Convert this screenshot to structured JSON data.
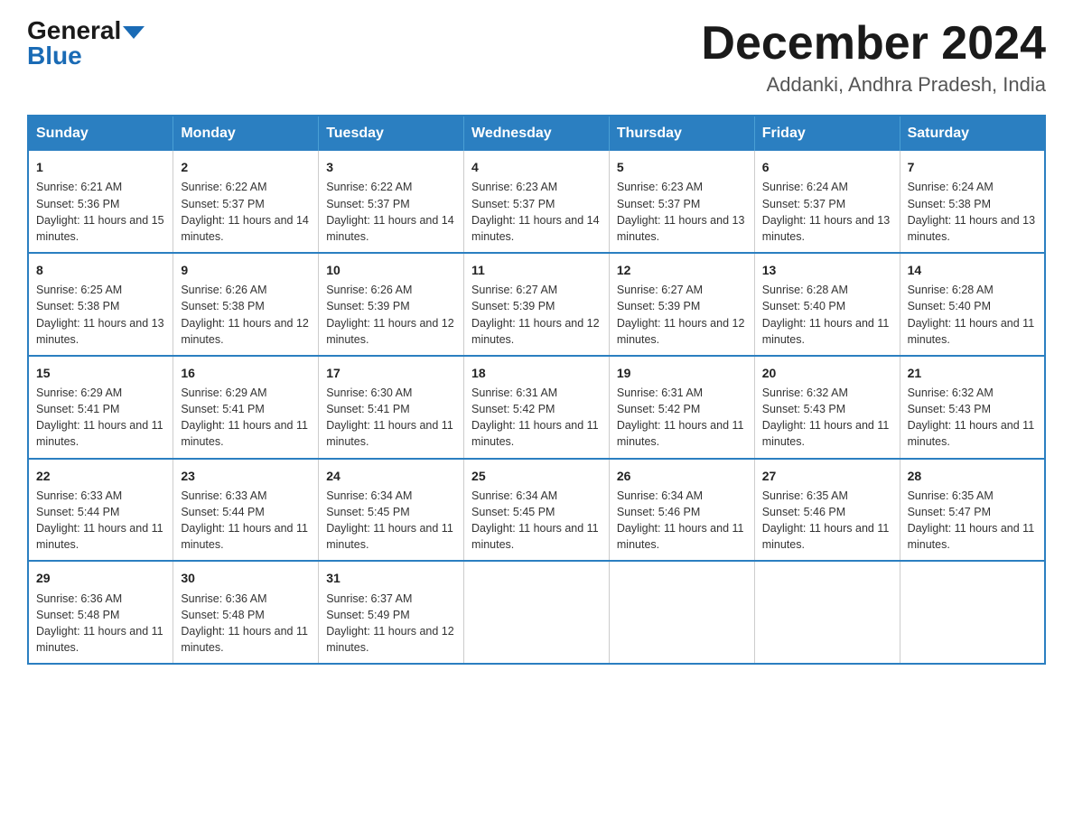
{
  "logo": {
    "line1": "General",
    "line2": "Blue"
  },
  "title": {
    "month_year": "December 2024",
    "location": "Addanki, Andhra Pradesh, India"
  },
  "headers": [
    "Sunday",
    "Monday",
    "Tuesday",
    "Wednesday",
    "Thursday",
    "Friday",
    "Saturday"
  ],
  "weeks": [
    [
      {
        "day": "1",
        "sunrise": "6:21 AM",
        "sunset": "5:36 PM",
        "daylight": "11 hours and 15 minutes."
      },
      {
        "day": "2",
        "sunrise": "6:22 AM",
        "sunset": "5:37 PM",
        "daylight": "11 hours and 14 minutes."
      },
      {
        "day": "3",
        "sunrise": "6:22 AM",
        "sunset": "5:37 PM",
        "daylight": "11 hours and 14 minutes."
      },
      {
        "day": "4",
        "sunrise": "6:23 AM",
        "sunset": "5:37 PM",
        "daylight": "11 hours and 14 minutes."
      },
      {
        "day": "5",
        "sunrise": "6:23 AM",
        "sunset": "5:37 PM",
        "daylight": "11 hours and 13 minutes."
      },
      {
        "day": "6",
        "sunrise": "6:24 AM",
        "sunset": "5:37 PM",
        "daylight": "11 hours and 13 minutes."
      },
      {
        "day": "7",
        "sunrise": "6:24 AM",
        "sunset": "5:38 PM",
        "daylight": "11 hours and 13 minutes."
      }
    ],
    [
      {
        "day": "8",
        "sunrise": "6:25 AM",
        "sunset": "5:38 PM",
        "daylight": "11 hours and 13 minutes."
      },
      {
        "day": "9",
        "sunrise": "6:26 AM",
        "sunset": "5:38 PM",
        "daylight": "11 hours and 12 minutes."
      },
      {
        "day": "10",
        "sunrise": "6:26 AM",
        "sunset": "5:39 PM",
        "daylight": "11 hours and 12 minutes."
      },
      {
        "day": "11",
        "sunrise": "6:27 AM",
        "sunset": "5:39 PM",
        "daylight": "11 hours and 12 minutes."
      },
      {
        "day": "12",
        "sunrise": "6:27 AM",
        "sunset": "5:39 PM",
        "daylight": "11 hours and 12 minutes."
      },
      {
        "day": "13",
        "sunrise": "6:28 AM",
        "sunset": "5:40 PM",
        "daylight": "11 hours and 11 minutes."
      },
      {
        "day": "14",
        "sunrise": "6:28 AM",
        "sunset": "5:40 PM",
        "daylight": "11 hours and 11 minutes."
      }
    ],
    [
      {
        "day": "15",
        "sunrise": "6:29 AM",
        "sunset": "5:41 PM",
        "daylight": "11 hours and 11 minutes."
      },
      {
        "day": "16",
        "sunrise": "6:29 AM",
        "sunset": "5:41 PM",
        "daylight": "11 hours and 11 minutes."
      },
      {
        "day": "17",
        "sunrise": "6:30 AM",
        "sunset": "5:41 PM",
        "daylight": "11 hours and 11 minutes."
      },
      {
        "day": "18",
        "sunrise": "6:31 AM",
        "sunset": "5:42 PM",
        "daylight": "11 hours and 11 minutes."
      },
      {
        "day": "19",
        "sunrise": "6:31 AM",
        "sunset": "5:42 PM",
        "daylight": "11 hours and 11 minutes."
      },
      {
        "day": "20",
        "sunrise": "6:32 AM",
        "sunset": "5:43 PM",
        "daylight": "11 hours and 11 minutes."
      },
      {
        "day": "21",
        "sunrise": "6:32 AM",
        "sunset": "5:43 PM",
        "daylight": "11 hours and 11 minutes."
      }
    ],
    [
      {
        "day": "22",
        "sunrise": "6:33 AM",
        "sunset": "5:44 PM",
        "daylight": "11 hours and 11 minutes."
      },
      {
        "day": "23",
        "sunrise": "6:33 AM",
        "sunset": "5:44 PM",
        "daylight": "11 hours and 11 minutes."
      },
      {
        "day": "24",
        "sunrise": "6:34 AM",
        "sunset": "5:45 PM",
        "daylight": "11 hours and 11 minutes."
      },
      {
        "day": "25",
        "sunrise": "6:34 AM",
        "sunset": "5:45 PM",
        "daylight": "11 hours and 11 minutes."
      },
      {
        "day": "26",
        "sunrise": "6:34 AM",
        "sunset": "5:46 PM",
        "daylight": "11 hours and 11 minutes."
      },
      {
        "day": "27",
        "sunrise": "6:35 AM",
        "sunset": "5:46 PM",
        "daylight": "11 hours and 11 minutes."
      },
      {
        "day": "28",
        "sunrise": "6:35 AM",
        "sunset": "5:47 PM",
        "daylight": "11 hours and 11 minutes."
      }
    ],
    [
      {
        "day": "29",
        "sunrise": "6:36 AM",
        "sunset": "5:48 PM",
        "daylight": "11 hours and 11 minutes."
      },
      {
        "day": "30",
        "sunrise": "6:36 AM",
        "sunset": "5:48 PM",
        "daylight": "11 hours and 11 minutes."
      },
      {
        "day": "31",
        "sunrise": "6:37 AM",
        "sunset": "5:49 PM",
        "daylight": "11 hours and 12 minutes."
      },
      null,
      null,
      null,
      null
    ]
  ],
  "labels": {
    "sunrise": "Sunrise:",
    "sunset": "Sunset:",
    "daylight": "Daylight:"
  }
}
